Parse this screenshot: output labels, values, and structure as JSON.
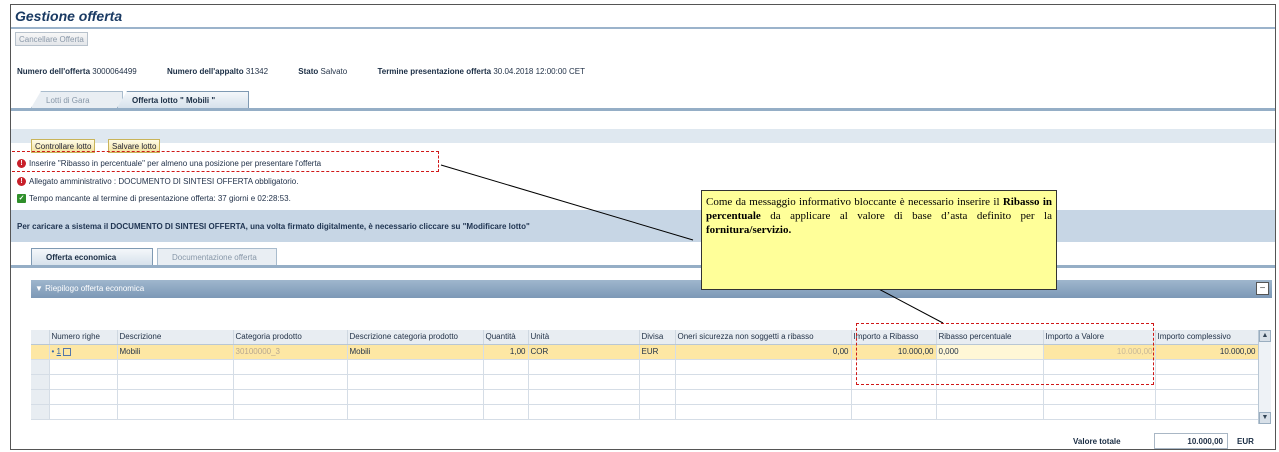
{
  "page": {
    "title": "Gestione offerta"
  },
  "toolbar": {
    "cancel_label": "Cancellare Offerta"
  },
  "info": {
    "offer_number_label": "Numero dell'offerta",
    "offer_number": "3000064499",
    "tender_number_label": "Numero dell'appalto",
    "tender_number": "31342",
    "status_label": "Stato",
    "status": "Salvato",
    "deadline_label": "Termine presentazione offerta",
    "deadline": "30.04.2018 12:00:00 CET"
  },
  "main_tabs": [
    {
      "label": "Lotti di Gara",
      "active": false
    },
    {
      "label": "Offerta lotto \" Mobili \"",
      "active": true
    }
  ],
  "lot_buttons": {
    "check": "Controllare lotto",
    "save": "Salvare lotto"
  },
  "messages": [
    {
      "type": "error",
      "text": "Inserire \"Ribasso in percentuale\" per almeno una posizione per presentare l'offerta"
    },
    {
      "type": "error",
      "text": "Allegato amministrativo : DOCUMENTO DI SINTESI OFFERTA obbligatorio."
    },
    {
      "type": "success",
      "text": "Tempo mancante al termine di presentazione offerta: 37  giorni e 02:28:53."
    }
  ],
  "info_bar": {
    "text": "Per caricare a sistema il DOCUMENTO DI SINTESI OFFERTA, una volta firmato digitalmente, è necessario cliccare su \"Modificare lotto\""
  },
  "sub_tabs": [
    {
      "label": "Offerta economica",
      "active": true
    },
    {
      "label": "Documentazione offerta",
      "active": false
    }
  ],
  "section": {
    "title": "Riepilogo offerta economica",
    "collapse_icon": "minus-icon"
  },
  "table": {
    "headers": [
      "",
      "Numero righe",
      "Descrizione",
      "Categoria prodotto",
      "Descrizione categoria prodotto",
      "Quantità",
      "Unità",
      "Divisa",
      "Oneri sicurezza non soggetti a ribasso",
      "Importo a Ribasso",
      "Ribasso percentuale",
      "Importo a Valore",
      "Importo complessivo"
    ],
    "rows": [
      {
        "line": "1",
        "descr": "Mobili",
        "category": "30100000_3",
        "category_descr": "Mobili",
        "qty": "1,00",
        "unit": "COR",
        "currency": "EUR",
        "safety": "0,00",
        "base": "10.000,00",
        "discount": "0,000",
        "value": "10.000,00",
        "total": "10.000,00"
      }
    ],
    "empty_rows": 4
  },
  "totals": {
    "label": "Valore totale",
    "value": "10.000,00",
    "currency": "EUR"
  },
  "callout": {
    "part1": "Come da messaggio informativo bloccante è necessario inserire il ",
    "bold1": "Ribasso in percentuale",
    "part2": " da applicare al valore di base d’asta definito per la ",
    "bold2": "fornitura/servizio."
  },
  "colors": {
    "error": "#c8202a",
    "success": "#2f8f2a",
    "highlight_row": "#fde7a4",
    "callout_bg": "#ffff99",
    "dash": "#d01818"
  }
}
